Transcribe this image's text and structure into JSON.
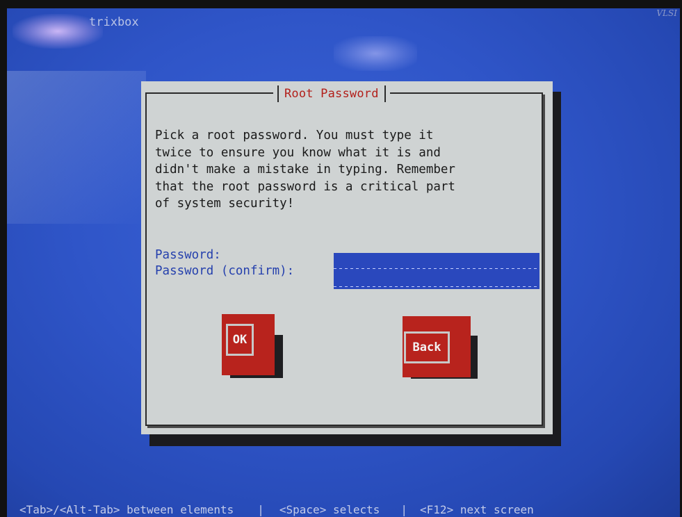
{
  "app": {
    "brand": "trixbox",
    "corner_tag": "VLSI"
  },
  "dialog": {
    "title": "Root Password",
    "intro": "Pick a root password. You must type it\ntwice to ensure you know what it is and\ndidn't make a mistake in typing. Remember\nthat the root password is a critical part\nof system security!",
    "fields": {
      "password": {
        "label": "Password:",
        "value": ""
      },
      "password_confirm": {
        "label": "Password (confirm):",
        "value": ""
      }
    },
    "buttons": {
      "ok": "OK",
      "back": "Back"
    }
  },
  "statusbar": {
    "tab_hint": "<Tab>/<Alt-Tab> between elements",
    "sep1": "|",
    "space_hint": "<Space> selects",
    "sep2": "|",
    "f12_hint": "<F12> next screen"
  },
  "colors": {
    "screen_blue": "#2f55c8",
    "dialog_gray": "#cfd3d3",
    "title_red": "#b21f1a",
    "button_red": "#b8231d",
    "label_blue": "#2540ad",
    "input_blue": "#2a48bd"
  }
}
